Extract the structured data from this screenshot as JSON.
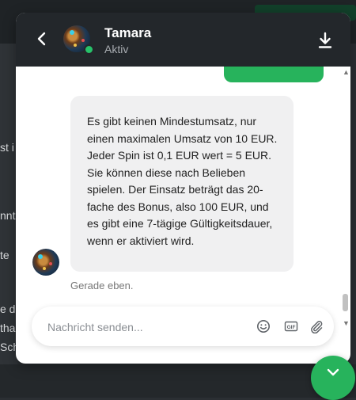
{
  "background": {
    "fragments": [
      "st i",
      "nnte",
      "te",
      "e de",
      "tha",
      "Sch"
    ]
  },
  "chat": {
    "agent_name": "Tamara",
    "agent_status": "Aktiv",
    "message_text": "Es gibt keinen Mindestumsatz, nur einen maximalen Umsatz von 10 EUR. Jeder Spin ist 0,1 EUR wert = 5 EUR. Sie können diese nach Belieben spielen. Der Einsatz beträgt das 20-fache des Bonus, also 100 EUR, und es gibt eine 7-tägige Gültigkeitsdauer, wenn er aktiviert wird.",
    "message_time": "Gerade eben.",
    "composer_placeholder": "Nachricht senden...",
    "gif_label": "GIF"
  },
  "icons": {
    "back": "chevron-left-icon",
    "download": "download-icon",
    "emoji": "smiley-icon",
    "gif": "gif-icon",
    "attach": "paperclip-icon",
    "fab": "chevron-down-icon"
  },
  "colors": {
    "header": "#23272b",
    "accent_green": "#27b35c",
    "agent_bubble": "#f0f0f1",
    "online": "#27c26a"
  }
}
